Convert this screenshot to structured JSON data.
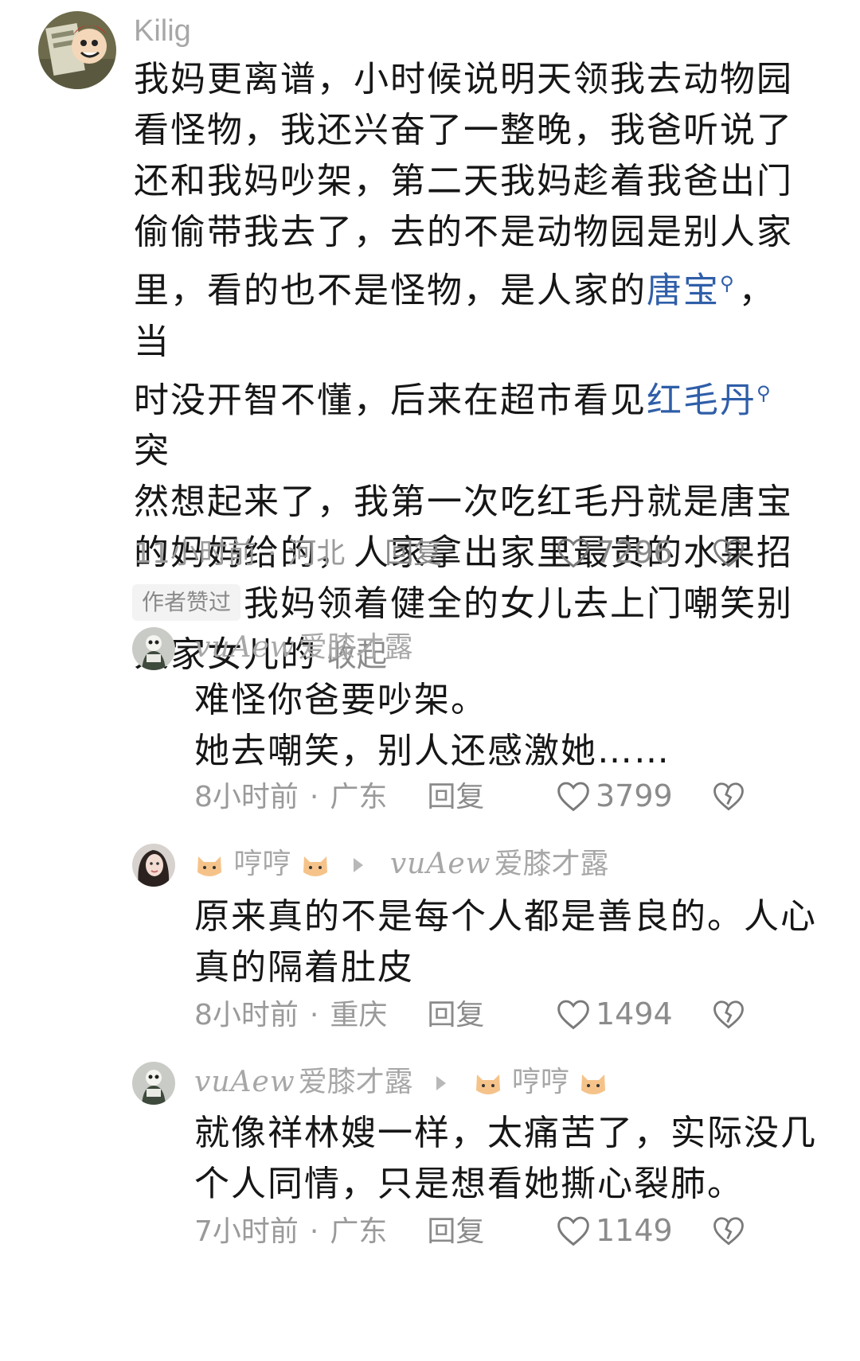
{
  "comments": [
    {
      "username": "Kilig",
      "text_lines": [
        "我妈更离谱，小时候说明天领我去动物园",
        "看怪物，我还兴奋了一整晚，我爸听说了",
        "还和我妈吵架，第二天我妈趁着我爸出门",
        "偷偷带我去了，去的不是动物园是别人家"
      ],
      "line5_pre": "里，看的也不是怪物，是人家的",
      "link1": "唐宝",
      "line5_post": "，当",
      "line6_pre": "时没开智不懂，后来在超市看见",
      "link2": "红毛丹",
      "line6_post": "突",
      "text_lines_tail": [
        "然想起来了，我第一次吃红毛丹就是唐宝",
        "的妈妈给的，人家拿出家里最贵的水果招",
        "待我，我妈领着健全的女儿去上门嘲笑别"
      ],
      "last_line": "人家女儿的",
      "collapse_label": "收起",
      "time": "11小时前",
      "location": "河北",
      "reply_label": "回复",
      "likes": "7296",
      "author_badge": "作者赞过"
    },
    {
      "username_cursive": "vuAew",
      "username_cn": "爱膝才露",
      "text_lines": [
        "难怪你爸要吵架。",
        "她去嘲笑，别人还感激她……"
      ],
      "time": "8小时前",
      "location": "广东",
      "reply_label": "回复",
      "likes": "3799"
    },
    {
      "username": "哼哼",
      "reply_to_cursive": "vuAew",
      "reply_to_cn": "爱膝才露",
      "text_lines": [
        "原来真的不是每个人都是善良的。人心",
        "真的隔着肚皮"
      ],
      "time": "8小时前",
      "location": "重庆",
      "reply_label": "回复",
      "likes": "1494"
    },
    {
      "username_cursive": "vuAew",
      "username_cn": "爱膝才露",
      "reply_to": "哼哼",
      "text_lines": [
        "就像祥林嫂一样，太痛苦了，实际没几",
        "个人同情，只是想看她撕心裂肺。"
      ],
      "time": "7小时前",
      "location": "广东",
      "reply_label": "回复",
      "likes": "1149"
    }
  ],
  "colors": {
    "link": "#2f5ea8",
    "meta": "#9a9a9a",
    "text": "#161616"
  },
  "icons": {
    "like": "heart-outline-icon",
    "dislike": "broken-heart-icon",
    "search": "search-icon",
    "reply_arrow": "triangle-right-icon"
  }
}
